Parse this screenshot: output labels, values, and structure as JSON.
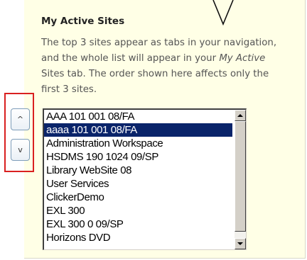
{
  "panel": {
    "heading": "My Active Sites",
    "description": {
      "line1": "The top 3 sites appear as tabs in your navigation,",
      "line2_prefix": "and the whole list will appear in your ",
      "line2_em": "My Active",
      "line3": "Sites tab. The order shown here affects only the",
      "line4": "first 3 sites."
    }
  },
  "order_controls": {
    "up_label": "^",
    "down_label": "v"
  },
  "site_list": {
    "selected_index": 1,
    "options": [
      "AAA 101 001 08/FA",
      "aaaa 101 001 08/FA",
      "Administration Workspace",
      "HSDMS 190 1024 09/SP",
      "Library WebSite 08",
      "User Services",
      "ClickerDemo",
      "EXL 300",
      "EXL 300 0 09/SP",
      "Horizons DVD"
    ]
  },
  "colors": {
    "panel_background": "#ffffe6",
    "highlight_border": "#d92020",
    "selection_background": "#0a246a"
  }
}
